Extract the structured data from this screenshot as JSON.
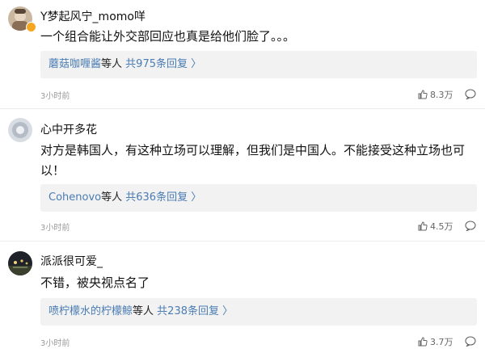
{
  "comments": [
    {
      "username": "Y梦起风宁_momo咩",
      "verified": true,
      "text": "一个组合能让外交部回应也真是给他们脸了。。。",
      "reply_user": "蘑菇咖喱酱",
      "reply_mid": "等人",
      "reply_count": "共975条回复",
      "reply_arrow": "〉",
      "time": "3小时前",
      "likes": "8.3万",
      "avatar_icon": "user-avatar-photo"
    },
    {
      "username": "心中开多花",
      "verified": false,
      "text": "对方是韩国人，有这种立场可以理解，但我们是中国人。不能接受这种立场也可以！",
      "reply_user": "Cohenovo",
      "reply_mid": "等人",
      "reply_count": "共636条回复",
      "reply_arrow": "〉",
      "time": "3小时前",
      "likes": "4.5万",
      "avatar_icon": "user-avatar-photo"
    },
    {
      "username": "派派很可爱_",
      "verified": false,
      "text": "不错，被央视点名了",
      "reply_user": "喷柠檬水的柠檬鲸",
      "reply_mid": "等人",
      "reply_count": "共238条回复",
      "reply_arrow": "〉",
      "time": "3小时前",
      "likes": "3.7万",
      "avatar_icon": "user-avatar-photo"
    }
  ],
  "colors": {
    "link": "#4a7cb3",
    "meta": "#9a9a9a",
    "reply_bg": "#f2f2f2",
    "divider": "#ececec",
    "verified_badge": "#f5a623"
  }
}
